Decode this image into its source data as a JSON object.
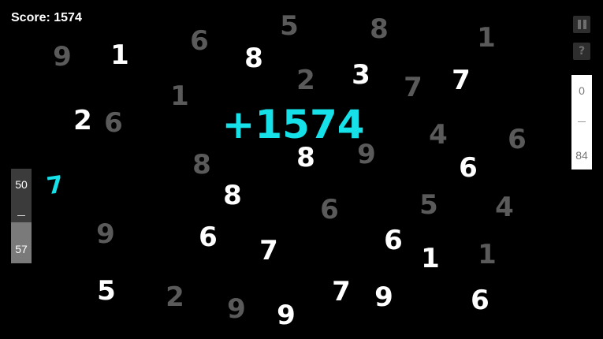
{
  "hud": {
    "score_label": "Score: 1574",
    "bonus_text": "+1574",
    "arrow_glyph": "7"
  },
  "left_gauge": {
    "top_value": "50",
    "separator": "–",
    "bottom_value": "57"
  },
  "right_gauge": {
    "top_value": "0",
    "separator": "–",
    "bottom_value": "84"
  },
  "buttons": {
    "help_label": "?"
  },
  "numbers": [
    {
      "value": "9",
      "style": "dim"
    },
    {
      "value": "1",
      "style": "bright"
    },
    {
      "value": "6",
      "style": "dim"
    },
    {
      "value": "5",
      "style": "dim"
    },
    {
      "value": "8",
      "style": "dim"
    },
    {
      "value": "1",
      "style": "dim"
    },
    {
      "value": "8",
      "style": "bright"
    },
    {
      "value": "2",
      "style": "dim"
    },
    {
      "value": "3",
      "style": "bright"
    },
    {
      "value": "7",
      "style": "dim"
    },
    {
      "value": "7",
      "style": "bright"
    },
    {
      "value": "1",
      "style": "dim"
    },
    {
      "value": "2",
      "style": "bright"
    },
    {
      "value": "6",
      "style": "dim"
    },
    {
      "value": "4",
      "style": "dim"
    },
    {
      "value": "6",
      "style": "dim"
    },
    {
      "value": "8",
      "style": "dim"
    },
    {
      "value": "8",
      "style": "bright"
    },
    {
      "value": "9",
      "style": "dim"
    },
    {
      "value": "6",
      "style": "bright"
    },
    {
      "value": "8",
      "style": "bright"
    },
    {
      "value": "6",
      "style": "dim"
    },
    {
      "value": "5",
      "style": "dim"
    },
    {
      "value": "4",
      "style": "dim"
    },
    {
      "value": "9",
      "style": "dim"
    },
    {
      "value": "6",
      "style": "bright"
    },
    {
      "value": "7",
      "style": "bright"
    },
    {
      "value": "6",
      "style": "bright"
    },
    {
      "value": "1",
      "style": "bright"
    },
    {
      "value": "1",
      "style": "dim"
    },
    {
      "value": "5",
      "style": "bright"
    },
    {
      "value": "2",
      "style": "dim"
    },
    {
      "value": "9",
      "style": "dim"
    },
    {
      "value": "9",
      "style": "bright"
    },
    {
      "value": "7",
      "style": "bright"
    },
    {
      "value": "9",
      "style": "bright"
    },
    {
      "value": "6",
      "style": "bright"
    }
  ],
  "colors": {
    "background": "#000000",
    "bright": "#ffffff",
    "dim": "#5a5a5a",
    "accent": "#16e0e8"
  }
}
